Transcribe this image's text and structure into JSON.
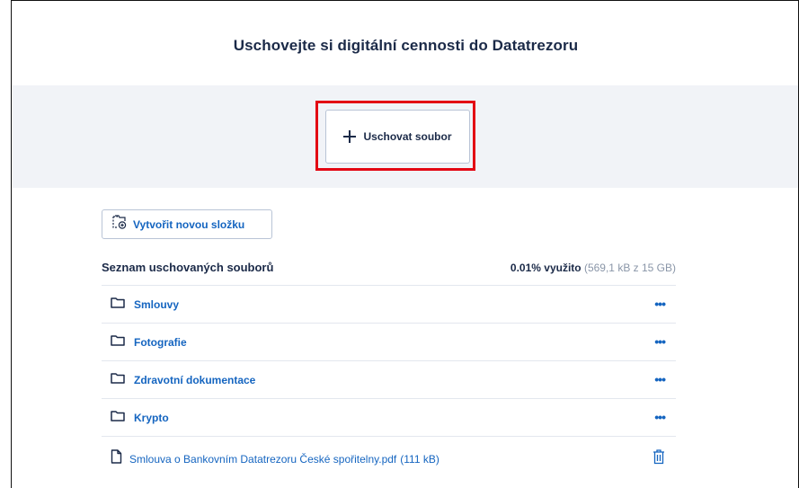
{
  "page": {
    "title": "Uschovejte si digitální cennosti do Datatrezoru"
  },
  "upload": {
    "label": "Uschovat soubor",
    "icon": "plus-icon",
    "highlight_color": "#e30613"
  },
  "new_folder": {
    "label": "Vytvořit novou složku",
    "icon": "new-folder-icon"
  },
  "list": {
    "title": "Seznam uschovaných souborů",
    "usage_percent": "0.01% využito",
    "usage_detail": "(569,1 kB z 15 GB)"
  },
  "folders": [
    {
      "label": "Smlouvy",
      "menu": "•••"
    },
    {
      "label": "Fotografie",
      "menu": "•••"
    },
    {
      "label": "Zdravotní dokumentace",
      "menu": "•••"
    },
    {
      "label": "Krypto",
      "menu": "•••"
    }
  ],
  "files": [
    {
      "label": "Smlouva o Bankovním Datatrezoru České spořitelny.pdf",
      "size": "(111 kB)"
    }
  ],
  "colors": {
    "link": "#1565c0",
    "heading": "#1b2a48",
    "band": "#f1f3f7"
  }
}
